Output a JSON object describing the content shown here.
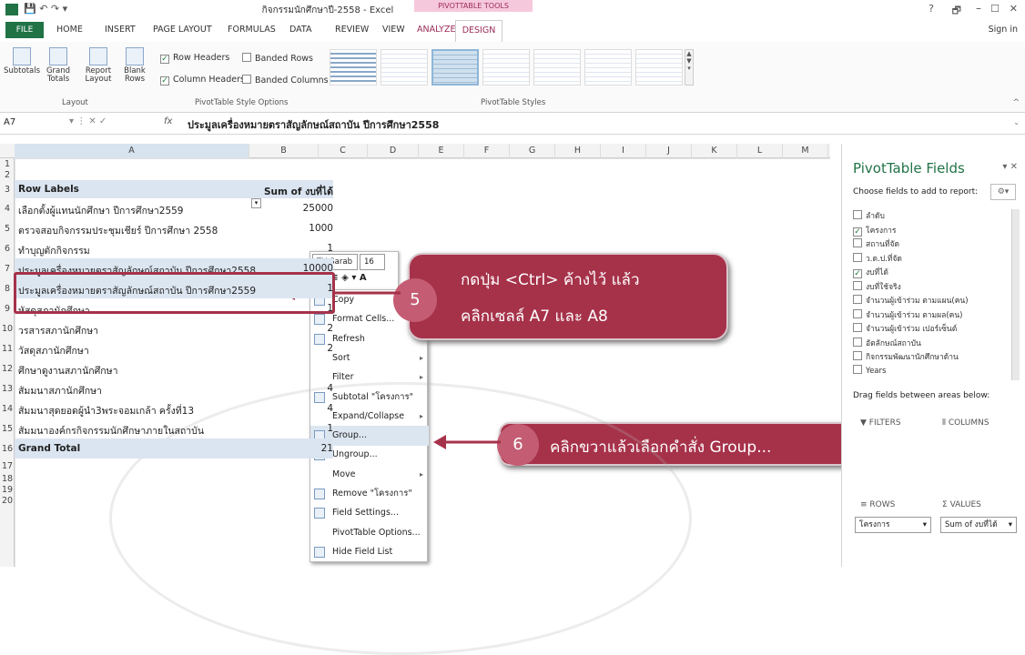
{
  "window": {
    "title": "กิจกรรมนักศึกษาปี-2558 - Excel",
    "context_tab": "PIVOTTABLE TOOLS",
    "help": "?",
    "restore": "🗗",
    "minimize": "–",
    "maximize": "☐",
    "close": "✕",
    "sign_in": "Sign in"
  },
  "tabs": {
    "file": "FILE",
    "home": "HOME",
    "insert": "INSERT",
    "page_layout": "PAGE LAYOUT",
    "formulas": "FORMULAS",
    "data": "DATA",
    "review": "REVIEW",
    "view": "VIEW",
    "analyze": "ANALYZE",
    "design": "DESIGN"
  },
  "ribbon": {
    "layout": {
      "subtotals": "Subtotals",
      "grand_totals": "Grand Totals",
      "report_layout": "Report Layout",
      "blank_rows": "Blank Rows",
      "group_label": "Layout"
    },
    "style_options": {
      "row_headers": "Row Headers",
      "column_headers": "Column Headers",
      "banded_rows": "Banded Rows",
      "banded_columns": "Banded Columns",
      "group_label": "PivotTable Style Options"
    },
    "styles": {
      "group_label": "PivotTable Styles"
    }
  },
  "formula_bar": {
    "name_box": "A7",
    "fx": "fx",
    "formula": "ประมูลเครื่องหมายตราสัญลักษณ์สถาบัน  ปีการศึกษา2558"
  },
  "columns": [
    "A",
    "B",
    "C",
    "D",
    "E",
    "F",
    "G",
    "H",
    "I",
    "J",
    "K",
    "L",
    "M"
  ],
  "rows": [
    {
      "n": "1",
      "label": "",
      "value": ""
    },
    {
      "n": "2",
      "label": "",
      "value": ""
    },
    {
      "n": "3",
      "label": "Row Labels",
      "value": "Sum of งบที่ได้"
    },
    {
      "n": "4",
      "label": "เลือกตั้งผู้แทนนักศึกษา ปีการศึกษา2559",
      "value": "25000"
    },
    {
      "n": "5",
      "label": "ตรวจสอบกิจกรรมประชุมเชียร์ ปีการศึกษา 2558",
      "value": "1000"
    },
    {
      "n": "6",
      "label": "ทำบุญตักกิจกรรม",
      "value": "1"
    },
    {
      "n": "7",
      "label": "ประมูลเครื่องหมายตราสัญลักษณ์สถาบัน ปีการศึกษา2558",
      "value": "10000"
    },
    {
      "n": "8",
      "label": "ประมูลเครื่องหมายตราสัญลักษณ์สถาบัน ปีการศึกษา2559",
      "value": "1"
    },
    {
      "n": "9",
      "label": "หัสดุสภานักศึกษา",
      "value": "1"
    },
    {
      "n": "10",
      "label": "วรสารสภานักศึกษา",
      "value": "2"
    },
    {
      "n": "11",
      "label": "วัสดุสภานักศึกษา",
      "value": "2"
    },
    {
      "n": "12",
      "label": "ศึกษาดูงานสภานักศึกษา",
      "value": ""
    },
    {
      "n": "13",
      "label": "สัมมนาสภานักศึกษา",
      "value": "4"
    },
    {
      "n": "14",
      "label": "สัมมนาสุดยอดผู้นำ3พระจอมเกล้า ครั้งที่13",
      "value": "4"
    },
    {
      "n": "15",
      "label": "สัมมนาองค์กรกิจกรรมนักศึกษาภายในสถาบัน",
      "value": "1"
    },
    {
      "n": "16",
      "label": "Grand Total",
      "value": "21"
    },
    {
      "n": "17",
      "label": "",
      "value": ""
    },
    {
      "n": "18",
      "label": "",
      "value": ""
    },
    {
      "n": "19",
      "label": "",
      "value": ""
    },
    {
      "n": "20",
      "label": "",
      "value": ""
    }
  ],
  "mini_toolbar": {
    "font": "TH Sarab",
    "size": "16"
  },
  "context_menu": [
    {
      "label": "Copy",
      "icon": "copy-icon",
      "sub": false
    },
    {
      "label": "Format Cells...",
      "icon": "format-cells-icon",
      "sub": false
    },
    {
      "label": "Refresh",
      "icon": "refresh-icon",
      "sub": false
    },
    {
      "label": "Sort",
      "icon": "",
      "sub": true
    },
    {
      "label": "Filter",
      "icon": "",
      "sub": true
    },
    {
      "label": "Subtotal \"โครงการ\"",
      "icon": "check-icon",
      "sub": false
    },
    {
      "label": "Expand/Collapse",
      "icon": "",
      "sub": true
    },
    {
      "label": "Group...",
      "icon": "group-icon",
      "sub": false
    },
    {
      "label": "Ungroup...",
      "icon": "ungroup-icon",
      "sub": false
    },
    {
      "label": "Move",
      "icon": "",
      "sub": true
    },
    {
      "label": "Remove \"โครงการ\"",
      "icon": "remove-icon",
      "sub": false
    },
    {
      "label": "Field Settings...",
      "icon": "field-settings-icon",
      "sub": false
    },
    {
      "label": "PivotTable Options...",
      "icon": "",
      "sub": false
    },
    {
      "label": "Hide Field List",
      "icon": "hide-list-icon",
      "sub": false
    }
  ],
  "callouts": {
    "step5": {
      "num": "5",
      "line1": "กดปุ่ม <Ctrl> ค้างไว้ แล้ว",
      "line2": "คลิกเซลล์ A7 และ A8"
    },
    "step6": {
      "num": "6",
      "text": "คลิกขวาแล้วเลือกคำสั่ง Group..."
    }
  },
  "pivot_pane": {
    "title": "PivotTable Fields",
    "choose": "Choose fields to add to report:",
    "fields": [
      {
        "label": "ลำดับ",
        "checked": false
      },
      {
        "label": "โครงการ",
        "checked": true
      },
      {
        "label": "สถานที่จัด",
        "checked": false
      },
      {
        "label": "ว.ด.ป.ที่จัด",
        "checked": false
      },
      {
        "label": "งบที่ได้",
        "checked": true
      },
      {
        "label": "งบที่ใช้จริง",
        "checked": false
      },
      {
        "label": "จำนวนผู้เข้าร่วม ตามแผน(คน)",
        "checked": false
      },
      {
        "label": "จำนวนผู้เข้าร่วม ตามผล(คน)",
        "checked": false
      },
      {
        "label": "จำนวนผู้เข้าร่วม เปอร์เซ็นต์",
        "checked": false
      },
      {
        "label": "อัตลักษณ์สถาบัน",
        "checked": false
      },
      {
        "label": "กิจกรรมพัฒนานักศึกษาด้าน",
        "checked": false
      },
      {
        "label": "Years",
        "checked": false
      }
    ],
    "drag_label": "Drag fields between areas below:",
    "filters": "FILTERS",
    "columns": "COLUMNS",
    "rows": "ROWS",
    "values": "VALUES",
    "rows_value": "โครงการ",
    "values_value": "Sum of งบที่ได้"
  },
  "colors": {
    "excel_green": "#217346",
    "pivot_pink": "#9b2b5a",
    "callout": "#a6324a"
  }
}
